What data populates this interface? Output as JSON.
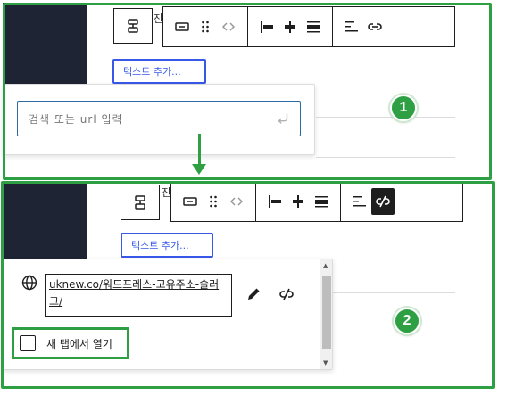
{
  "colors": {
    "annotation_green": "#2ea043",
    "link_blue": "#3858e9",
    "sidebar_dark": "#1e2433"
  },
  "step1": {
    "badge_number": "1",
    "add_text_button": "텍스트 추가...",
    "partial_label": "잔",
    "url_input_placeholder": "검색 또는 url 입력",
    "toolbar_icons": [
      "parent-block-icon",
      "block-type-icon",
      "drag-handle-icon",
      "move-arrows-icon",
      "align-left-icon",
      "align-center-icon",
      "align-wide-icon",
      "justify-icon",
      "link-icon"
    ]
  },
  "step2": {
    "badge_number": "2",
    "add_text_button": "텍스트 추가...",
    "partial_label": "잔",
    "link_url": "uknew.co/워드프레스-고유주소-슬러그/",
    "open_new_tab_label": "새 탭에서 열기",
    "open_new_tab_checked": false,
    "toolbar_icons": [
      "parent-block-icon",
      "block-type-icon",
      "drag-handle-icon",
      "move-arrows-icon",
      "align-left-icon",
      "align-center-icon",
      "align-wide-icon",
      "justify-icon",
      "unlink-icon"
    ]
  }
}
